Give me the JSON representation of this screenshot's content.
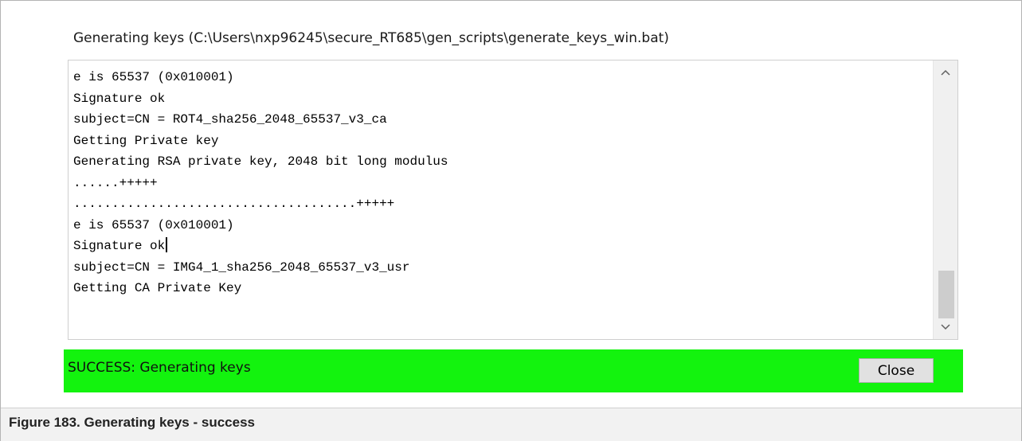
{
  "window": {
    "title": "Generating keys (C:\\Users\\nxp96245\\secure_RT685\\gen_scripts\\generate_keys_win.bat)"
  },
  "output": {
    "lines": [
      "e is 65537 (0x010001)",
      "Signature ok",
      "subject=CN = ROT4_sha256_2048_65537_v3_ca",
      "Getting Private key",
      "Generating RSA private key, 2048 bit long modulus",
      "......+++++",
      ".....................................+++++",
      "e is 65537 (0x010001)",
      "Signature ok",
      "subject=CN = IMG4_1_sha256_2048_65537_v3_usr",
      "Getting CA Private Key"
    ],
    "scroll_up_icon": "chevron-up-icon",
    "scroll_down_icon": "chevron-down-icon"
  },
  "status": {
    "text": "SUCCESS: Generating keys",
    "color": "#13f30e",
    "close_label": "Close"
  },
  "caption": {
    "text": "Figure 183.  Generating keys - success"
  }
}
